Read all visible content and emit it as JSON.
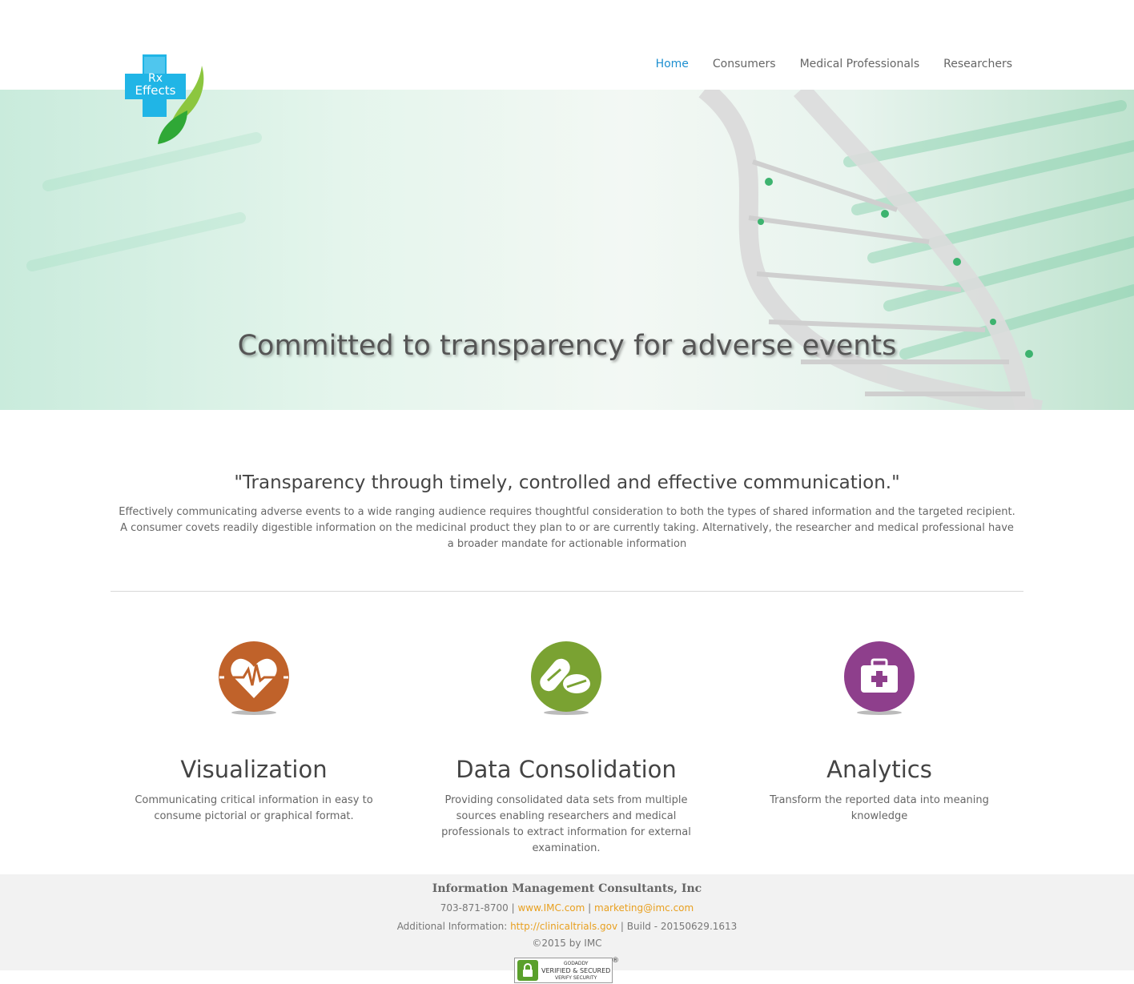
{
  "brand": {
    "logo_line1": "Rx",
    "logo_line2": "Effects"
  },
  "nav": {
    "items": [
      {
        "label": "Home",
        "active": true
      },
      {
        "label": "Consumers",
        "active": false
      },
      {
        "label": "Medical Professionals",
        "active": false
      },
      {
        "label": "Researchers",
        "active": false
      }
    ]
  },
  "hero": {
    "title": "Committed to transparency for adverse events"
  },
  "intro": {
    "quote": "\"Transparency through timely, controlled and effective communication.\"",
    "body": "Effectively communicating adverse events to a wide ranging audience requires thoughtful consideration to both the types of shared information and the targeted recipient. A consumer covets readily digestible information on the medicinal product they plan to or are currently taking. Alternatively, the researcher and medical professional have a broader mandate for actionable information"
  },
  "features": [
    {
      "icon": "heart-pulse-icon",
      "color": "#c0622a",
      "title": "Visualization",
      "text": "Communicating critical information in easy to consume pictorial or graphical format."
    },
    {
      "icon": "pill-icon",
      "color": "#7aa232",
      "title": "Data Consolidation",
      "text": "Providing consolidated data sets from multiple sources enabling researchers and medical professionals to extract information for external examination."
    },
    {
      "icon": "medical-bag-icon",
      "color": "#8e3f8c",
      "title": "Analytics",
      "text": "Transform the reported data into meaning knowledge"
    }
  ],
  "footer": {
    "company": "Information Management Consultants, Inc",
    "phone": "703-871-8700",
    "sep": " | ",
    "website": "www.IMC.com",
    "email": "marketing@imc.com",
    "additional_label": "Additional Information: ",
    "additional_link": "http://clinicaltrials.gov",
    "build": " | Build - 20150629.1613",
    "copyright": "©2015 by IMC"
  },
  "badge": {
    "line1": "GODADDY",
    "line2": "VERIFIED & SECURED",
    "line3": "VERIFY SECURITY",
    "reg": "®"
  },
  "colors": {
    "nav_active": "#1d8fd0",
    "link": "#e8a020",
    "logo_blue": "#1fb3e8",
    "logo_green": "#6cc04a"
  }
}
